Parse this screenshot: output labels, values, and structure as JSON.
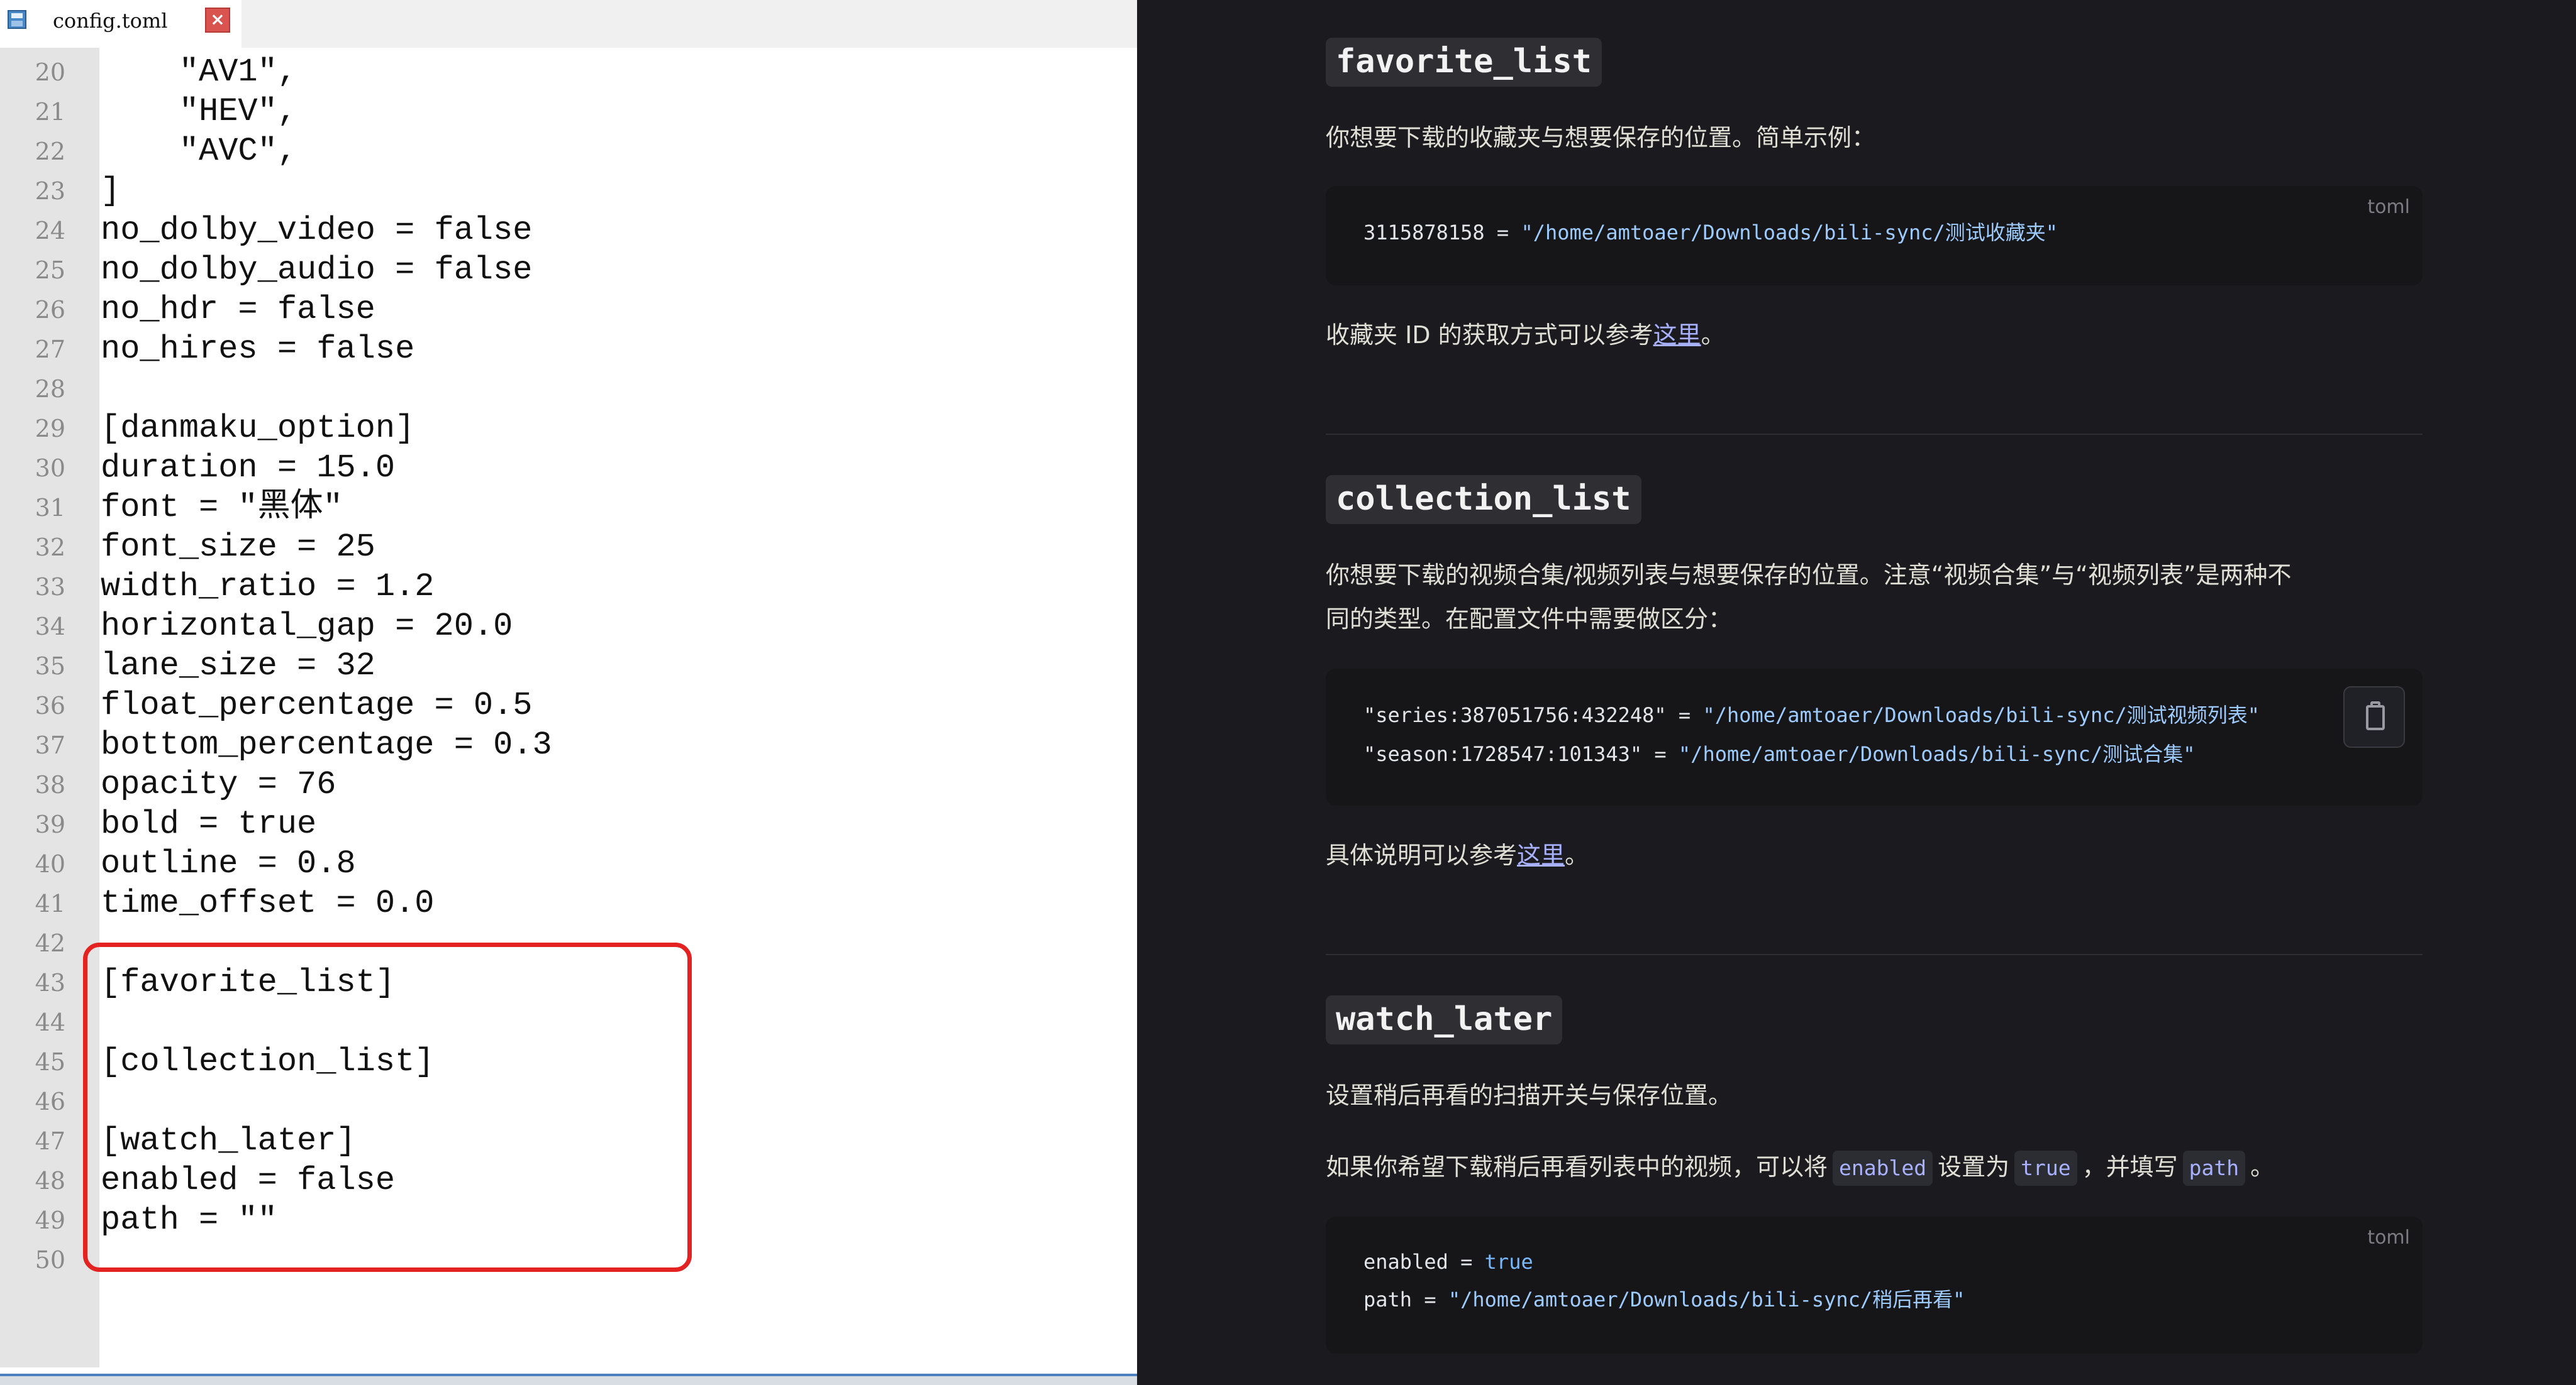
{
  "editor": {
    "tab_title": "config.toml",
    "lines": [
      {
        "n": "20",
        "text": "    \"AV1\","
      },
      {
        "n": "21",
        "text": "    \"HEV\","
      },
      {
        "n": "22",
        "text": "    \"AVC\","
      },
      {
        "n": "23",
        "text": "]"
      },
      {
        "n": "24",
        "text": "no_dolby_video = false"
      },
      {
        "n": "25",
        "text": "no_dolby_audio = false"
      },
      {
        "n": "26",
        "text": "no_hdr = false"
      },
      {
        "n": "27",
        "text": "no_hires = false"
      },
      {
        "n": "28",
        "text": ""
      },
      {
        "n": "29",
        "text": "[danmaku_option]"
      },
      {
        "n": "30",
        "text": "duration = 15.0"
      },
      {
        "n": "31",
        "text": "font = \"黑体\""
      },
      {
        "n": "32",
        "text": "font_size = 25"
      },
      {
        "n": "33",
        "text": "width_ratio = 1.2"
      },
      {
        "n": "34",
        "text": "horizontal_gap = 20.0"
      },
      {
        "n": "35",
        "text": "lane_size = 32"
      },
      {
        "n": "36",
        "text": "float_percentage = 0.5"
      },
      {
        "n": "37",
        "text": "bottom_percentage = 0.3"
      },
      {
        "n": "38",
        "text": "opacity = 76"
      },
      {
        "n": "39",
        "text": "bold = true"
      },
      {
        "n": "40",
        "text": "outline = 0.8"
      },
      {
        "n": "41",
        "text": "time_offset = 0.0"
      },
      {
        "n": "42",
        "text": ""
      },
      {
        "n": "43",
        "text": "[favorite_list]"
      },
      {
        "n": "44",
        "text": ""
      },
      {
        "n": "45",
        "text": "[collection_list]"
      },
      {
        "n": "46",
        "text": ""
      },
      {
        "n": "47",
        "text": "[watch_later]"
      },
      {
        "n": "48",
        "text": "enabled = false"
      },
      {
        "n": "49",
        "text": "path = \"\""
      },
      {
        "n": "50",
        "text": ""
      }
    ]
  },
  "docs": {
    "favorite": {
      "heading": "favorite_list",
      "desc": "你想要下载的收藏夹与想要保存的位置。简单示例：",
      "code_lang": "toml",
      "code_key": "3115878158",
      "code_eq": " = ",
      "code_val": "\"/home/amtoaer/Downloads/bili-sync/测试收藏夹\"",
      "note_prefix": "收藏夹 ID 的获取方式可以参考",
      "note_link": "这里",
      "note_suffix": "。"
    },
    "collection": {
      "heading": "collection_list",
      "desc_line1": "你想要下载的视频合集/视频列表与想要保存的位置。注意“视频合集”与“视频列表”是两种不",
      "desc_line2": "同的类型。在配置文件中需要做区分：",
      "code_key1": "\"series:387051756:432248\"",
      "code_val1": "\"/home/amtoaer/Downloads/bili-sync/测试视频列表\"",
      "code_key2": "\"season:1728547:101343\"",
      "code_val2": "\"/home/amtoaer/Downloads/bili-sync/测试合集\"",
      "code_eq": " = ",
      "note_prefix": "具体说明可以参考",
      "note_link": "这里",
      "note_suffix": "。",
      "copy_icon": "clipboard-icon"
    },
    "watch_later": {
      "heading": "watch_later",
      "desc": "设置稍后再看的扫描开关与保存位置。",
      "p2_prefix": "如果你希望下载稍后再看列表中的视频，可以将",
      "p2_code1": "enabled",
      "p2_mid1": "设置为",
      "p2_code2": "true",
      "p2_mid2": "，并填写",
      "p2_code3": "path",
      "p2_suffix": "。",
      "code_lang": "toml",
      "code_k1": "enabled",
      "code_v1": "true",
      "code_k2": "path",
      "code_v2": "\"/home/amtoaer/Downloads/bili-sync/稍后再看\"",
      "code_eq": " = "
    }
  }
}
